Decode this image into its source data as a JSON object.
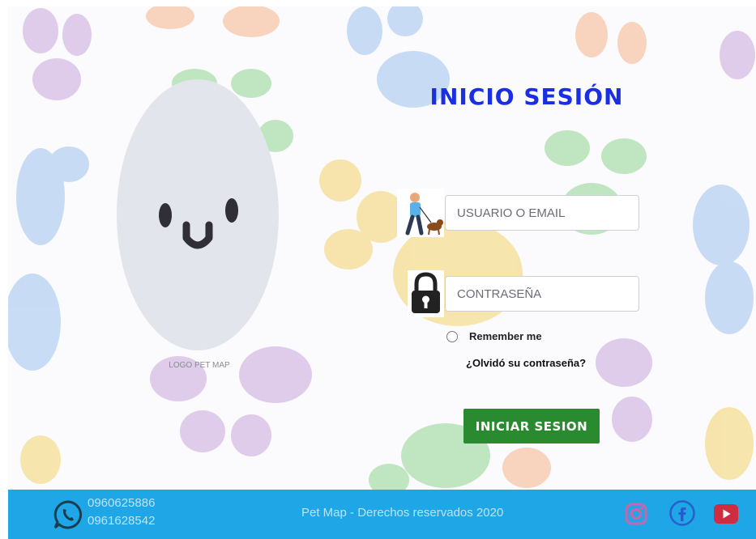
{
  "login": {
    "title": "INICIO SESIÓN",
    "username_placeholder": "USUARIO O EMAIL",
    "password_placeholder": "CONTRASEÑA",
    "remember_label": "Remember me",
    "forgot_link": "¿Olvidó su contraseña?",
    "submit_label": "INICIAR SESION"
  },
  "logo": {
    "caption": "LOGO PET MAP"
  },
  "footer": {
    "phone_1": "0960625886",
    "phone_2": "0961628542",
    "copyright": "Pet Map - Derechos reservados 2020",
    "social": [
      "whatsapp-icon",
      "instagram-icon",
      "facebook-icon",
      "youtube-icon"
    ]
  },
  "colors": {
    "title": "#1a2fe0",
    "submit_button": "#2a8a2f",
    "footer": "#1ea6e6"
  }
}
